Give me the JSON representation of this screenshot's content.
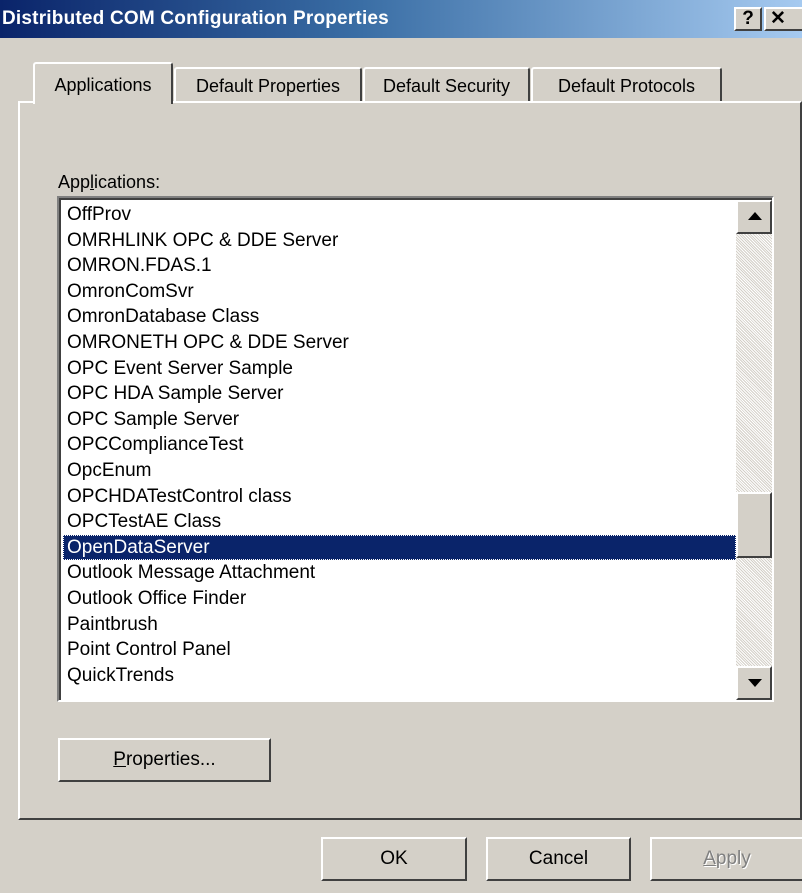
{
  "window": {
    "title": "Distributed COM Configuration Properties",
    "help_glyph": "?",
    "close_glyph": "✕"
  },
  "tabs": [
    {
      "label": "Applications",
      "active": true
    },
    {
      "label": "Default Properties",
      "active": false
    },
    {
      "label": "Default Security",
      "active": false
    },
    {
      "label": "Default Protocols",
      "active": false
    }
  ],
  "applications_label": "Applications:",
  "applications_list": {
    "items": [
      "OffProv",
      "OMRHLINK OPC & DDE Server",
      "OMRON.FDAS.1",
      "OmronComSvr",
      "OmronDatabase Class",
      "OMRONETH OPC & DDE Server",
      "OPC Event Server Sample",
      "OPC HDA Sample Server",
      "OPC Sample Server",
      "OPCComplianceTest",
      "OpcEnum",
      "OPCHDATestControl class",
      "OPCTestAE Class",
      "OpenDataServer",
      "Outlook Message Attachment",
      "Outlook Office Finder",
      "Paintbrush",
      "Point Control Panel",
      "QuickTrends"
    ],
    "selected": "OpenDataServer"
  },
  "buttons": {
    "properties_label": "Properties...",
    "ok_label": "OK",
    "cancel_label": "Cancel",
    "apply_label": "Apply",
    "apply_enabled": false
  },
  "colors": {
    "titlebar_start": "#0a246a",
    "titlebar_end": "#a6caf0",
    "selection": "#0a246a",
    "face": "#d4d0c8"
  }
}
